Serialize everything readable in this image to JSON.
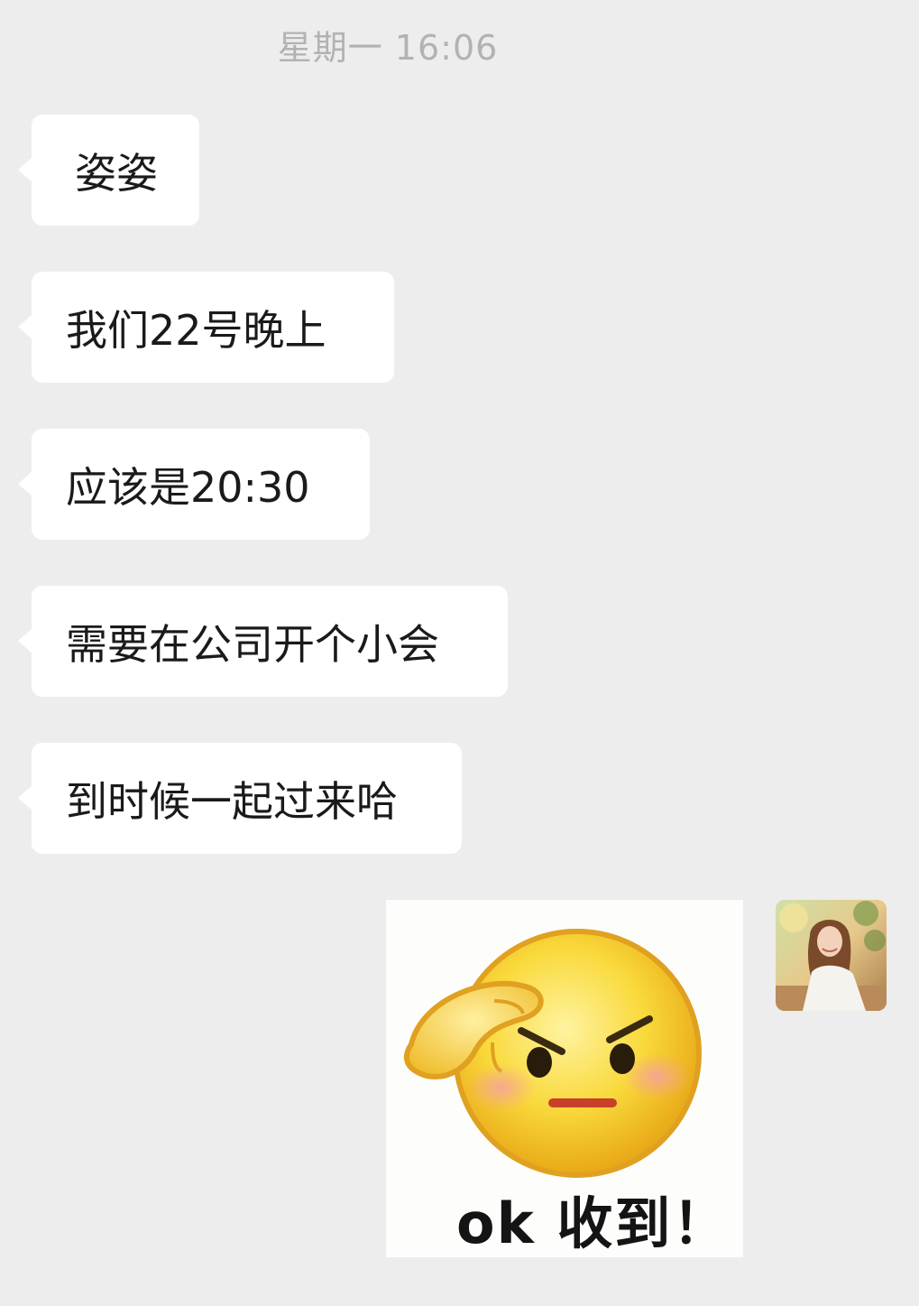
{
  "timestamp": "星期一 16:06",
  "messages": [
    {
      "text": "姿姿",
      "side": "left"
    },
    {
      "text": "我们22号晚上",
      "side": "left"
    },
    {
      "text": "应该是20:30",
      "side": "left"
    },
    {
      "text": "需要在公司开个小会",
      "side": "left"
    },
    {
      "text": "到时候一起过来哈",
      "side": "left"
    }
  ],
  "sticker": {
    "caption": "ok 收到！",
    "icon": "saluting-emoji-icon"
  },
  "avatar": {
    "icon": "user-avatar-photo"
  },
  "colors": {
    "background": "#ededed",
    "bubble": "#ffffff",
    "timestamp": "#b2b2b2",
    "text": "#1a1a1a",
    "emoji_face": "#f7c52b"
  }
}
